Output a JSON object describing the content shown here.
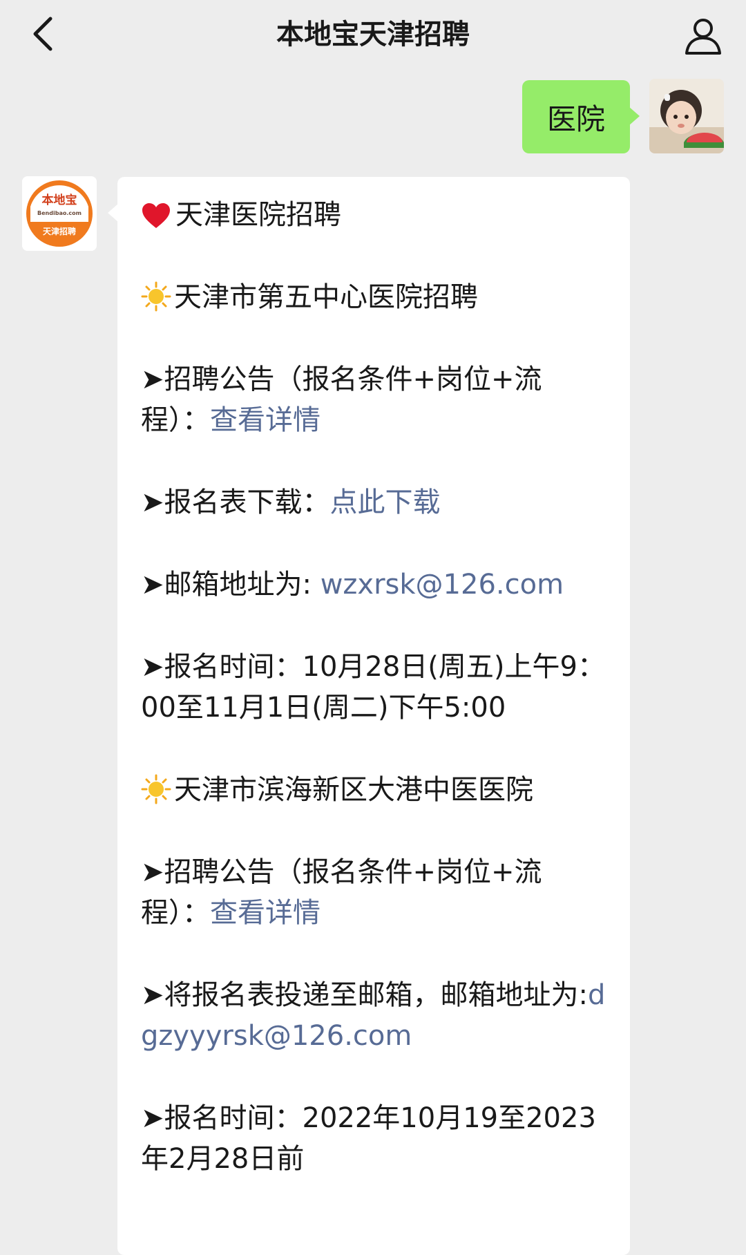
{
  "header": {
    "title": "本地宝天津招聘",
    "back_icon": "chevron-left-icon",
    "profile_icon": "person-icon"
  },
  "outgoing": {
    "text": "医院",
    "bubble_color": "#95ec69"
  },
  "bot_avatar": {
    "brand": "本地宝",
    "site": "Bendibao.com",
    "sub": "天津招聘",
    "accent": "#f07a1e"
  },
  "message": {
    "heading": "天津医院招聘",
    "hospital1": {
      "name": "天津市第五中心医院招聘",
      "notice_label": "招聘公告（报名条件+岗位+流程）：",
      "notice_link": "查看详情",
      "form_label": "报名表下载：",
      "form_link": "点此下载",
      "email_label": "邮箱地址为:",
      "email": "wzxrsk@126.com",
      "time_text": "报名时间：10月28日(周五)上午9：00至11月1日(周二)下午5:00"
    },
    "hospital2": {
      "name": "天津市滨海新区大港中医医院",
      "notice_label": "招聘公告（报名条件+岗位+流程）：",
      "notice_link": "查看详情",
      "email_label": "将报名表投递至邮箱，邮箱地址为:",
      "email": "dgzyyyrsk@126.com",
      "time_text": "报名时间：2022年10月19至2023年2月28日前"
    },
    "bullet": "➤",
    "link_color": "#576b95"
  }
}
